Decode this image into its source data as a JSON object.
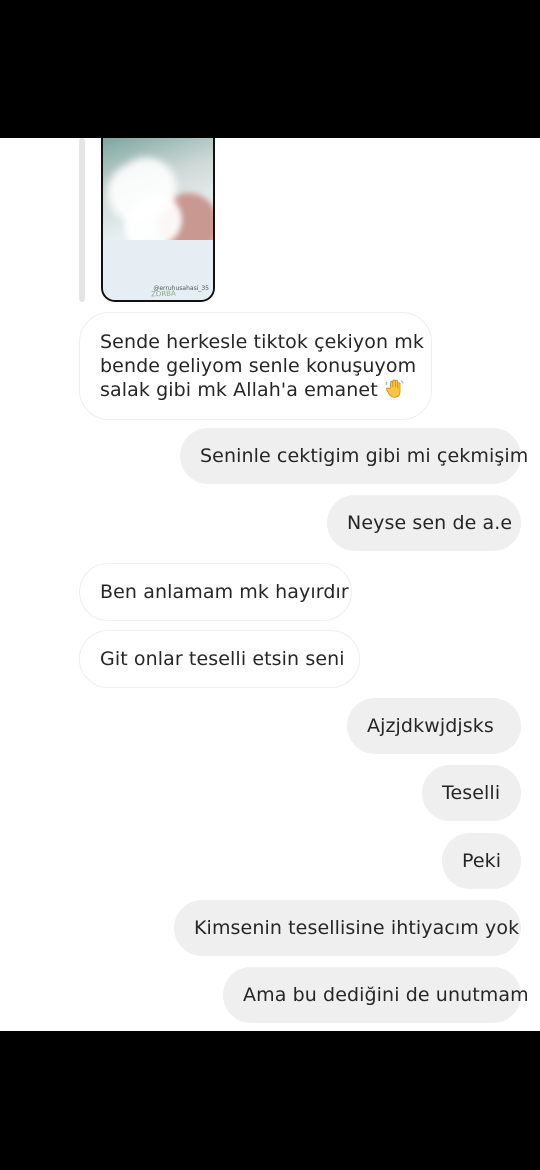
{
  "chat": {
    "shared_post": {
      "handle": "@erruhusahasi_35",
      "brand": "ZORBA"
    },
    "messages": [
      {
        "side": "in",
        "lines": [
          "Sende herkesle tiktok çekiyon mk",
          "bende geliyom senle konuşuyom",
          "salak gibi mk Allah'a emanet"
        ],
        "emoji": "waving-hand"
      },
      {
        "side": "out",
        "text": "Seninle cektigim gibi mi çekmişim"
      },
      {
        "side": "out",
        "text": "Neyse sen de a.e"
      },
      {
        "side": "in",
        "text": "Ben anlamam mk hayırdır"
      },
      {
        "side": "in",
        "text": "Git onlar teselli etsin seni"
      },
      {
        "side": "out",
        "text": "Ajzjdkwjdjsks"
      },
      {
        "side": "out",
        "text": "Teselli"
      },
      {
        "side": "out",
        "text": "Peki"
      },
      {
        "side": "out",
        "text": "Kimsenin tesellisine ihtiyacım yok"
      },
      {
        "side": "out",
        "text": "Ama bu dediğini de unutmam"
      }
    ]
  },
  "colors": {
    "incoming_bubble": "#ffffff",
    "incoming_border": "#eeeeee",
    "outgoing_bubble": "#efefef",
    "text": "#262626"
  }
}
